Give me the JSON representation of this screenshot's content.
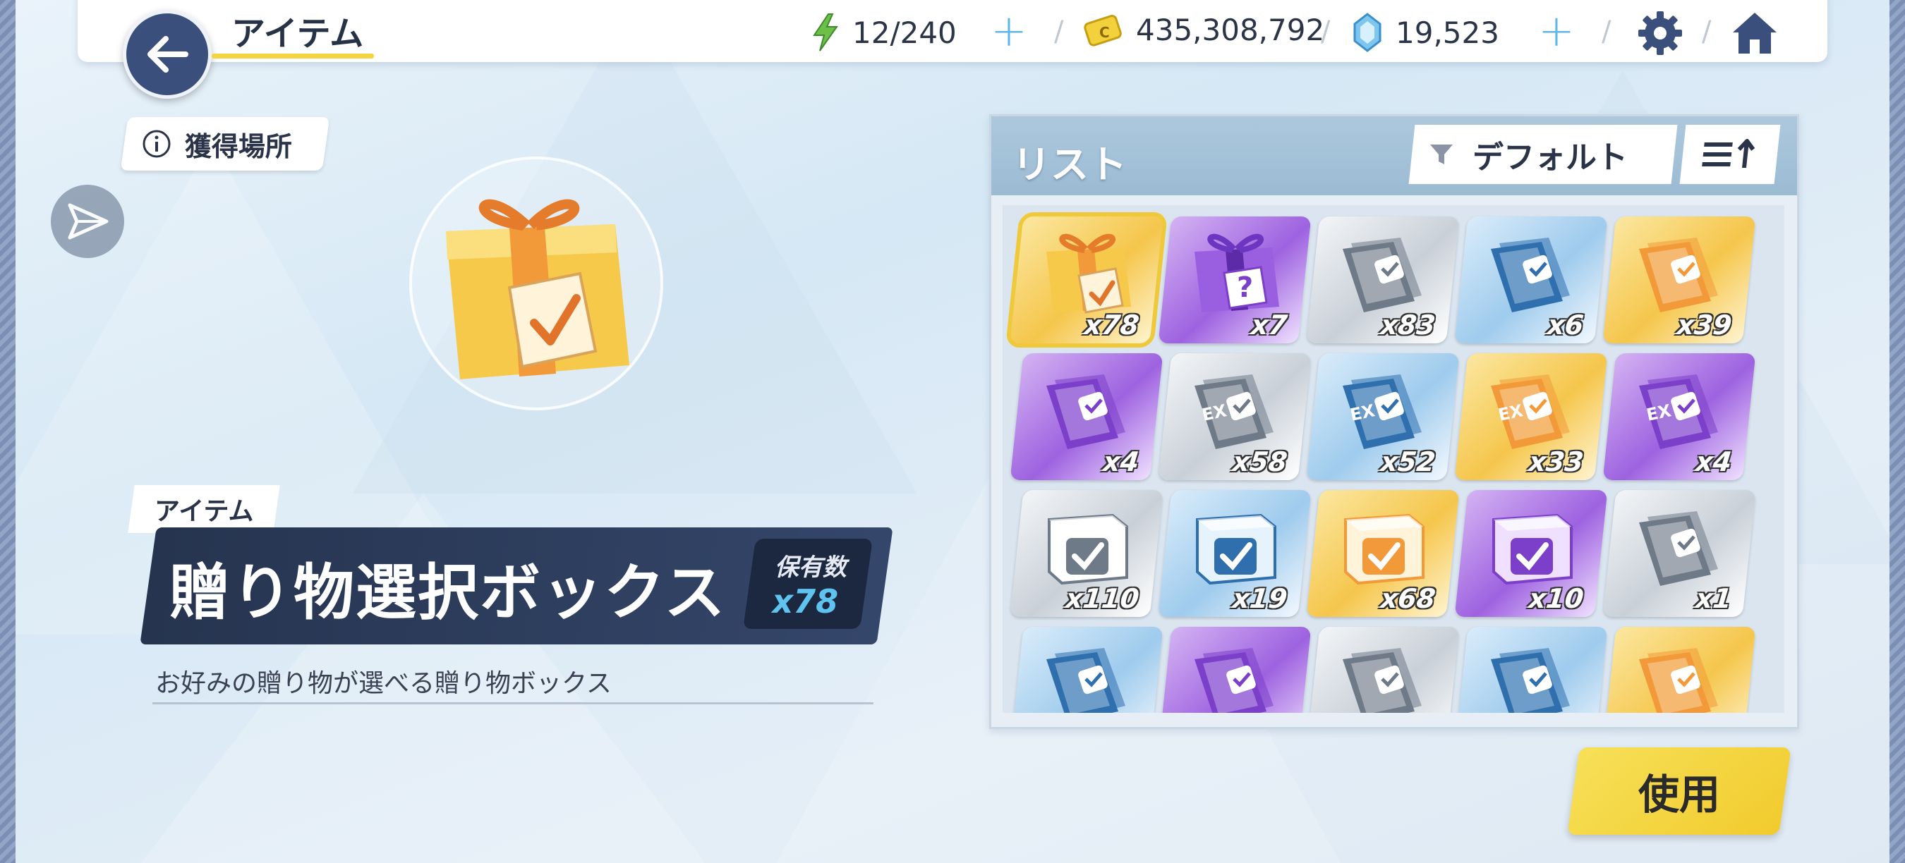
{
  "header": {
    "title": "アイテム",
    "stamina": "12/240",
    "coins": "435,308,792",
    "gems": "19,523"
  },
  "left": {
    "source_button": "獲得場所",
    "category": "アイテム",
    "item_name": "贈り物選択ボックス",
    "owned_label": "保有数",
    "owned_count": "x78",
    "description": "お好みの贈り物が選べる贈り物ボックス"
  },
  "list": {
    "title": "リスト",
    "sort_label": "デフォルト",
    "items": [
      {
        "icon": "gift-box-icon",
        "color": "gold",
        "qty": "x78",
        "selected": true
      },
      {
        "icon": "mystery-gift-icon",
        "color": "purple",
        "qty": "x7"
      },
      {
        "icon": "select-ticket-icon",
        "color": "silver",
        "qty": "x83"
      },
      {
        "icon": "select-ticket-icon",
        "color": "blue",
        "qty": "x6"
      },
      {
        "icon": "select-ticket-icon",
        "color": "gold",
        "qty": "x39"
      },
      {
        "icon": "select-ticket-icon",
        "color": "purple",
        "qty": "x4"
      },
      {
        "icon": "ex-select-ticket-icon",
        "color": "silver",
        "qty": "x58"
      },
      {
        "icon": "ex-select-ticket-icon",
        "color": "blue",
        "qty": "x52"
      },
      {
        "icon": "ex-select-ticket-icon",
        "color": "gold",
        "qty": "x33"
      },
      {
        "icon": "ex-select-ticket-icon",
        "color": "purple",
        "qty": "x4"
      },
      {
        "icon": "select-box-icon",
        "color": "silver",
        "qty": "x110"
      },
      {
        "icon": "select-box-icon",
        "color": "blue",
        "qty": "x19"
      },
      {
        "icon": "select-box-icon",
        "color": "gold",
        "qty": "x68"
      },
      {
        "icon": "select-box-icon",
        "color": "purple",
        "qty": "x10"
      },
      {
        "icon": "select-ticket-icon",
        "color": "silver",
        "qty": "x1"
      },
      {
        "icon": "select-ticket-icon",
        "color": "blue",
        "qty": ""
      },
      {
        "icon": "select-ticket-icon",
        "color": "purple",
        "qty": ""
      },
      {
        "icon": "select-ticket-icon",
        "color": "silver",
        "qty": ""
      },
      {
        "icon": "select-ticket-icon",
        "color": "blue",
        "qty": ""
      },
      {
        "icon": "select-ticket-icon",
        "color": "gold",
        "qty": ""
      }
    ]
  },
  "use_button": "使用",
  "colors": {
    "accent_yellow": "#f4d440",
    "navy": "#3a4f7c",
    "owned_count": "#5ec4ef"
  }
}
